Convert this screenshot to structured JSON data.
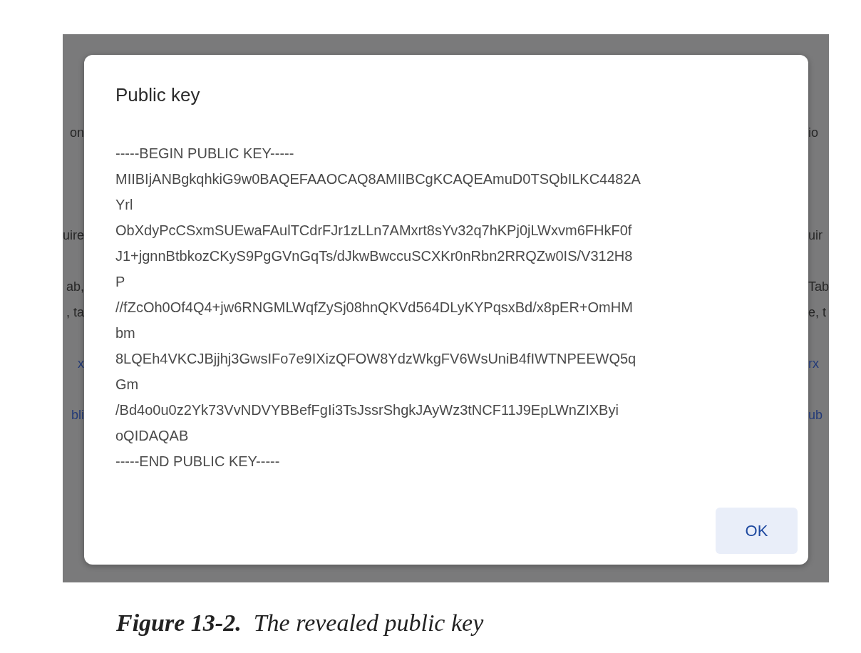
{
  "background_left": [
    {
      "text": "on",
      "kind": "text"
    },
    {
      "text": "uire",
      "kind": "text"
    },
    {
      "text": "ab,",
      "kind": "text"
    },
    {
      "text": ", ta",
      "kind": "text"
    },
    {
      "text": "x",
      "kind": "link"
    },
    {
      "text": "bli",
      "kind": "link"
    }
  ],
  "background_right": [
    {
      "text": "io",
      "kind": "text"
    },
    {
      "text": "uir",
      "kind": "text"
    },
    {
      "text": "Tab",
      "kind": "text"
    },
    {
      "text": "e, t",
      "kind": "text"
    },
    {
      "text": "rx",
      "kind": "link"
    },
    {
      "text": "ub",
      "kind": "link"
    }
  ],
  "dialog": {
    "title": "Public key",
    "key_lines": [
      "-----BEGIN PUBLIC KEY-----",
      "MIIBIjANBgkqhkiG9w0BAQEFAAOCAQ8AMIIBCgKCAQEAmuD0TSQbILKC4482A",
      "Yrl",
      "ObXdyPcCSxmSUEwaFAulTCdrFJr1zLLn7AMxrt8sYv32q7hKPj0jLWxvm6FHkF0f",
      "J1+jgnnBtbkozCKyS9PgGVnGqTs/dJkwBwccuSCXKr0nRbn2RRQZw0IS/V312H8",
      "P",
      "//fZcOh0Of4Q4+jw6RNGMLWqfZySj08hnQKVd564DLyKYPqsxBd/x8pER+OmHM",
      "bm",
      "8LQEh4VKCJBjjhj3GwsIFo7e9IXizQFOW8YdzWkgFV6WsUniB4fIWTNPEEWQ5q",
      "Gm",
      "/Bd4o0u0z2Yk73VvNDVYBBefFgIi3TsJssrShgkJAyWz3tNCF11J9EpLWnZIXByi",
      "oQIDAQAB",
      "-----END PUBLIC KEY-----"
    ],
    "buttons": [
      "OK"
    ]
  },
  "caption": "**Figure 13-2.**  The revealed public key"
}
